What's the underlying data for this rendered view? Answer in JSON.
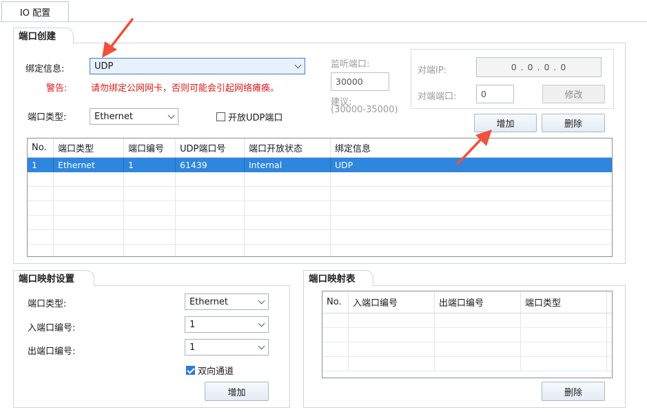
{
  "tab": {
    "label": "IO 配置"
  },
  "port_create": {
    "title": "端口创建",
    "bind_label": "绑定信息:",
    "bind_value": "UDP",
    "warn_label": "警告:",
    "warn_text": "请勿绑定公网网卡，否则可能会引起网络瘫痪。",
    "port_type_label": "端口类型:",
    "port_type_value": "Ethernet",
    "open_udp_label": "开放UDP端口",
    "listen_label": "监听端口:",
    "listen_value": "30000",
    "suggest_label": "建议:",
    "suggest_range": "(30000-35000)",
    "peer_ip_label": "对端IP:",
    "peer_ip_value": "0 . 0 . 0 . 0",
    "peer_port_label": "对端端口:",
    "peer_port_value": "0",
    "modify_button": "修改",
    "add_button": "增加",
    "delete_button": "删除",
    "table": {
      "headers": [
        "No.",
        "端口类型",
        "端口编号",
        "UDP端口号",
        "端口开放状态",
        "绑定信息"
      ],
      "rows": [
        [
          "1",
          "Ethernet",
          "1",
          "61439",
          "Internal",
          "UDP"
        ]
      ]
    }
  },
  "mapping_settings": {
    "title": "端口映射设置",
    "port_type_label": "端口类型:",
    "port_type_value": "Ethernet",
    "in_port_label": "入端口编号:",
    "in_port_value": "1",
    "out_port_label": "出端口编号:",
    "out_port_value": "1",
    "bidirectional_label": "双向通道",
    "add_button": "增加"
  },
  "mapping_table": {
    "title": "端口映射表",
    "headers": [
      "No.",
      "入端口编号",
      "出端口编号",
      "端口类型"
    ],
    "delete_button": "删除"
  },
  "colors": {
    "selection": "#2e86de",
    "warning": "#e01818",
    "arrow": "#f0503c"
  }
}
